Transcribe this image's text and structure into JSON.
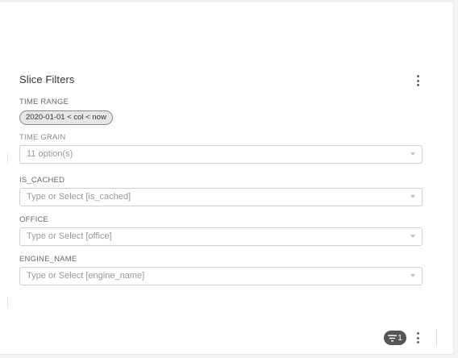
{
  "panel": {
    "title": "Slice Filters"
  },
  "time_range": {
    "label": "TIME RANGE",
    "value": "2020-01-01 < col < now"
  },
  "time_grain": {
    "label": "TIME GRAIN",
    "value": "11 option(s)"
  },
  "is_cached": {
    "label": "IS_CACHED",
    "placeholder": "Type or Select [is_cached]"
  },
  "office": {
    "label": "OFFICE",
    "placeholder": "Type or Select [office]"
  },
  "engine_name": {
    "label": "ENGINE_NAME",
    "placeholder": "Type or Select [engine_name]"
  },
  "footer": {
    "filter_count": "1",
    "filter_icon": "filter-icon",
    "menu_icon": "kebab-menu-icon"
  },
  "colors": {
    "badge_bg": "#555555",
    "pill_bg": "#e6e6e6",
    "title_text": "#323232"
  }
}
